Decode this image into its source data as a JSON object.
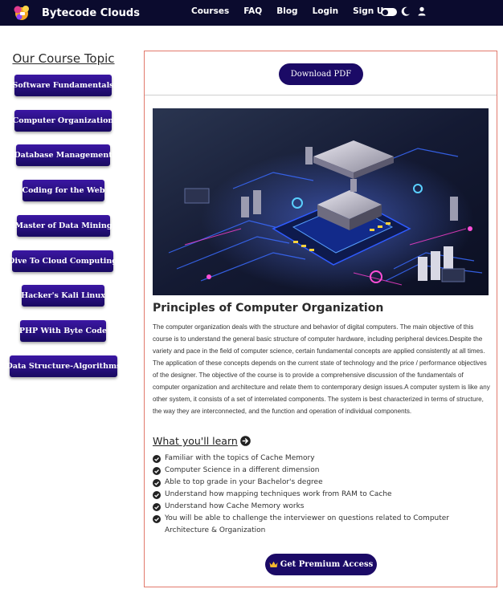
{
  "brand": {
    "name": "Bytecode Clouds"
  },
  "nav": {
    "links": [
      "Courses",
      "FAQ",
      "Blog",
      "Login",
      "Sign Up"
    ],
    "icons": [
      "theme-toggle",
      "moon-icon",
      "user-icon"
    ]
  },
  "sidebar": {
    "title": "Our Course Topic",
    "items": [
      "Software Fundamentals",
      "Computer Organization",
      "Database Management",
      "Coding for the Web",
      "Master of Data Mining",
      "Dive To Cloud Computing",
      "Hacker's Kali Linux",
      "PHP With Byte Code",
      "Data Structure-Algorithms"
    ]
  },
  "main": {
    "download_label": "Download PDF",
    "course_title": "Principles of Computer Organization",
    "description": "The computer organization deals with the structure and behavior of digital computers. The main objective of this course is to understand the general basic structure of computer hardware, including peripheral devices.Despite the variety and pace in the field of computer science, certain fundamental concepts are applied consistently at all times. The application of these concepts depends on the current state of technology and the price / performance objectives of the designer. The objective of the course is to provide a comprehensive discussion of the fundamentals of computer organization and architecture and relate them to contemporary design issues.A computer system is like any other system, it consists of a set of interrelated components. The system is best characterized in terms of structure, the way they are interconnected, and the function and operation of individual components.",
    "learn_heading": "What you'll learn",
    "learn_items": [
      "Familiar with the topics of Cache Memory",
      "Computer Science in a different dimension",
      "Able to top grade in your Bachelor's degree",
      "Understand how mapping techniques work from RAM to Cache",
      "Understand how Cache Memory works",
      "You will be able to challenge the interviewer on questions related to Computer Architecture & Organization"
    ],
    "premium_label": "Get Premium Access"
  },
  "colors": {
    "navbar": "#0b0b2e",
    "button": "#1b0a66",
    "panel_border": "#e2796c"
  }
}
